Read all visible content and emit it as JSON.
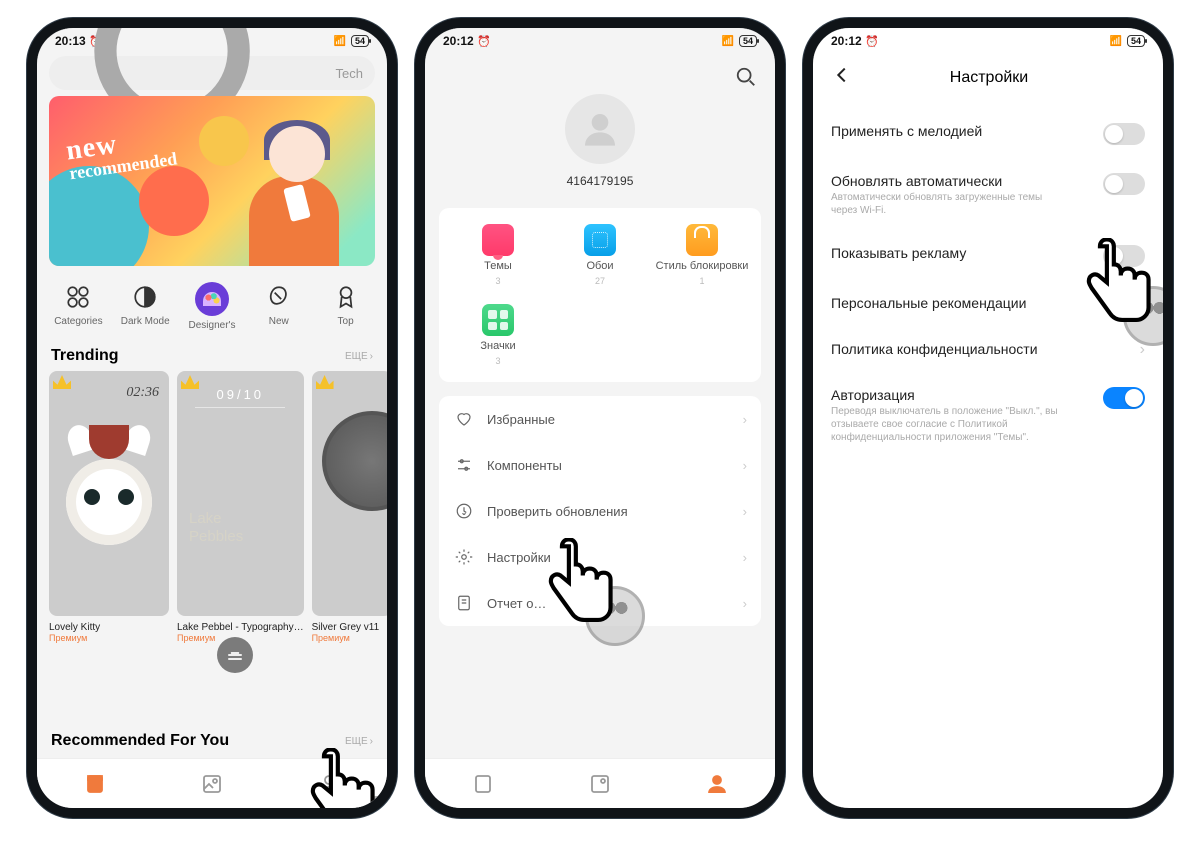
{
  "status": {
    "time1": "20:13",
    "time2": "20:12",
    "time3": "20:12",
    "battery": "54"
  },
  "screen1": {
    "search_placeholder": "Tech",
    "banner": {
      "line1": "new",
      "line2": "recommended"
    },
    "categories": [
      {
        "key": "categories",
        "label": "Categories"
      },
      {
        "key": "darkmode",
        "label": "Dark Mode"
      },
      {
        "key": "designers",
        "label": "Designer's"
      },
      {
        "key": "new",
        "label": "New"
      },
      {
        "key": "top",
        "label": "Top"
      }
    ],
    "trending_title": "Trending",
    "more_label": "ЕЩЕ",
    "themes": [
      {
        "name": "Lovely Kitty",
        "tag": "Премиум",
        "clock": "02:36"
      },
      {
        "name": "Lake Pebbel - Typography…",
        "tag": "Премиум",
        "date": "09/10",
        "overlay1": "Lake",
        "overlay2": "Pebbles"
      },
      {
        "name": "Silver Grey v11",
        "tag": "Премиум"
      }
    ],
    "rec_title": "Recommended For You"
  },
  "screen2": {
    "user_id": "4164179195",
    "tiles": [
      {
        "label": "Темы",
        "count": "3",
        "icon": "themes"
      },
      {
        "label": "Обои",
        "count": "27",
        "icon": "wall"
      },
      {
        "label": "Стиль блокировки",
        "count": "1",
        "icon": "lock"
      },
      {
        "label": "Значки",
        "count": "3",
        "icon": "icons-t"
      }
    ],
    "menu": [
      {
        "key": "favorites",
        "label": "Избранные"
      },
      {
        "key": "components",
        "label": "Компоненты"
      },
      {
        "key": "updates",
        "label": "Проверить обновления"
      },
      {
        "key": "settings",
        "label": "Настройки"
      },
      {
        "key": "report",
        "label": "Отчет о…"
      }
    ]
  },
  "screen3": {
    "title": "Настройки",
    "rows": [
      {
        "key": "melody",
        "label": "Применять с мелодией",
        "toggle": "off"
      },
      {
        "key": "auto",
        "label": "Обновлять автоматически",
        "sub": "Автоматически обновлять загруженные темы через Wi-Fi.",
        "toggle": "off"
      },
      {
        "key": "ads",
        "label": "Показывать рекламу",
        "toggle": "off"
      },
      {
        "key": "personal",
        "label": "Персональные рекомендации",
        "chev": true
      },
      {
        "key": "privacy",
        "label": "Политика конфиденциальности",
        "chev": true
      },
      {
        "key": "auth",
        "label": "Авторизация",
        "sub": "Переводя выключатель в положение \"Выкл.\", вы отзываете свое согласие с Политикой конфиденциальности приложения \"Темы\".",
        "toggle": "on"
      }
    ]
  }
}
